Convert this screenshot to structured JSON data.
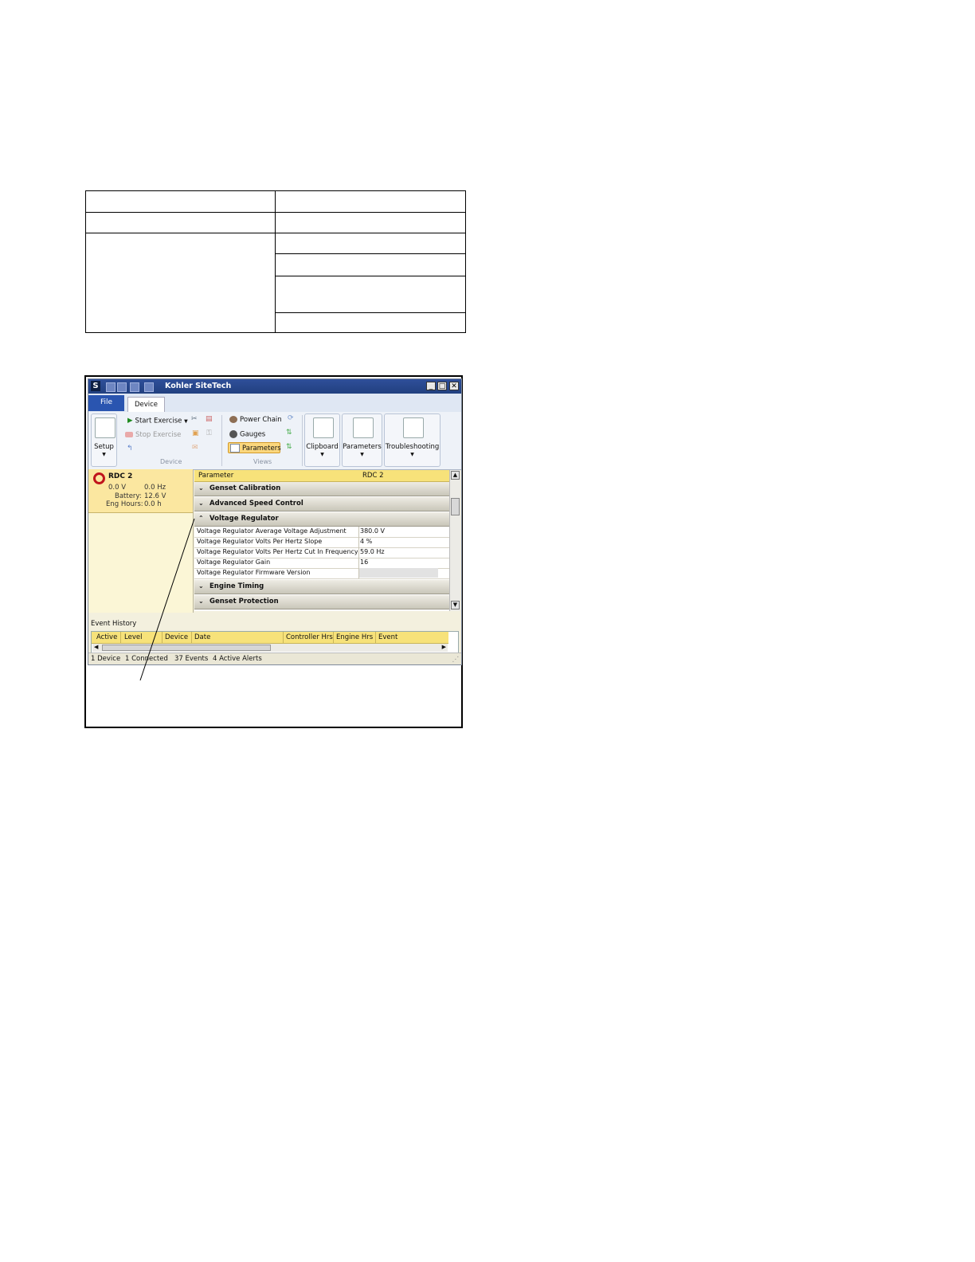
{
  "window": {
    "logo": "S",
    "title": "Kohler SiteTech",
    "controls": {
      "minimize": "_",
      "maximize": "□",
      "close": "✕"
    }
  },
  "tabs": {
    "file": "File",
    "device": "Device"
  },
  "ribbon": {
    "setup": "Setup",
    "start_exercise": "Start Exercise",
    "stop_exercise": "Stop Exercise",
    "device_group": "Device",
    "power_chain": "Power Chain",
    "gauges": "Gauges",
    "parameters_view": "Parameters",
    "views_group": "Views",
    "clipboard": "Clipboard",
    "parameters": "Parameters",
    "troubleshooting": "Troubleshooting",
    "dropdown_glyph": "▼",
    "accent_color": "#fbd77d"
  },
  "device": {
    "name": "RDC 2",
    "voltage": "0.0 V",
    "frequency": "0.0 Hz",
    "battery_label": "Battery:",
    "battery": "12.6 V",
    "eng_hours_label": "Eng Hours:",
    "eng_hours": "0.0 h",
    "status_color": "#c0141c"
  },
  "param_grid": {
    "col_parameter": "Parameter",
    "col_device": "RDC 2",
    "categories": {
      "genset_calibration": "Genset Calibration",
      "advanced_speed_control": "Advanced Speed Control",
      "voltage_regulator": "Voltage Regulator",
      "engine_timing": "Engine Timing",
      "genset_protection": "Genset Protection"
    },
    "rows": [
      {
        "name": "Voltage Regulator Average Voltage Adjustment",
        "value": "380.0 V"
      },
      {
        "name": "Voltage Regulator Volts Per Hertz Slope",
        "value": "4 %"
      },
      {
        "name": "Voltage Regulator Volts Per Hertz Cut In Frequency",
        "value": "59.0 Hz"
      },
      {
        "name": "Voltage Regulator Gain",
        "value": "16"
      },
      {
        "name": "Voltage Regulator Firmware Version",
        "value": ""
      }
    ]
  },
  "event_history": {
    "label": "Event History",
    "columns": [
      "Active",
      "Level",
      "Device",
      "Date",
      "Controller Hrs",
      "Engine Hrs",
      "Event"
    ]
  },
  "status_bar": {
    "devices": "1 Device",
    "connected": "1 Connected",
    "events": "37 Events",
    "alerts": "4 Active Alerts"
  }
}
